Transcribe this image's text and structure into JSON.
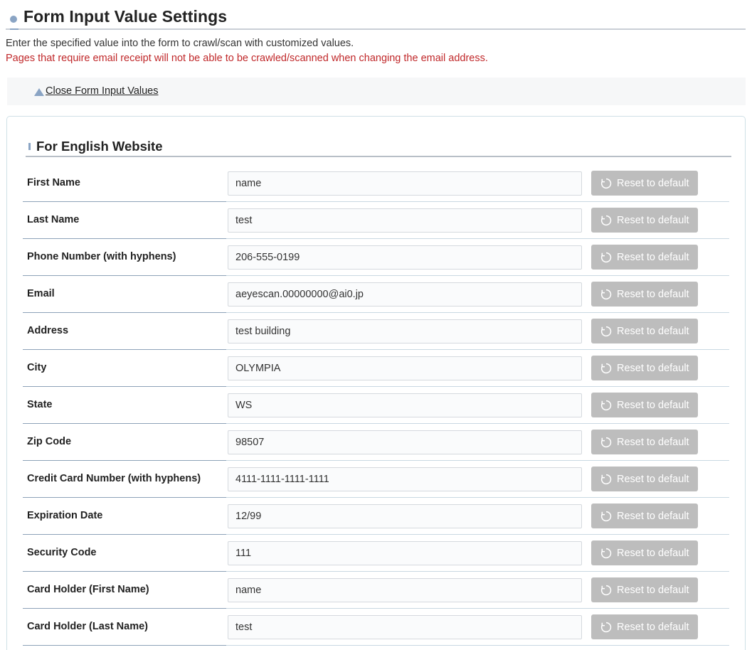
{
  "page": {
    "title": "Form Input Value Settings",
    "description": "Enter the specified value into the form to crawl/scan with customized values.",
    "warning": "Pages that require email receipt will not be able to be crawled/scanned when changing the email address.",
    "toggle_label": "Close Form Input Values"
  },
  "section": {
    "title": "For English Website"
  },
  "reset_label": "Reset to default",
  "fields": [
    {
      "label": "First Name",
      "value": "name"
    },
    {
      "label": "Last Name",
      "value": "test"
    },
    {
      "label": "Phone Number (with hyphens)",
      "value": "206-555-0199"
    },
    {
      "label": "Email",
      "value": "aeyescan.00000000@ai0.jp"
    },
    {
      "label": "Address",
      "value": "test building"
    },
    {
      "label": "City",
      "value": "OLYMPIA"
    },
    {
      "label": "State",
      "value": "WS"
    },
    {
      "label": "Zip Code",
      "value": "98507"
    },
    {
      "label": "Credit Card Number (with hyphens)",
      "value": "4111-1111-1111-1111"
    },
    {
      "label": "Expiration Date",
      "value": "12/99"
    },
    {
      "label": "Security Code",
      "value": "111"
    },
    {
      "label": "Card Holder (First Name)",
      "value": "name"
    },
    {
      "label": "Card Holder (Last Name)",
      "value": "test"
    }
  ],
  "colors": {
    "accent": "#8aa4c4",
    "warning": "#c0282a",
    "reset_button": "#bdbdbd"
  },
  "icons": {
    "title_bullet": "circle-bullet-icon",
    "toggle": "triangle-up-icon",
    "reset": "reset-icon"
  }
}
